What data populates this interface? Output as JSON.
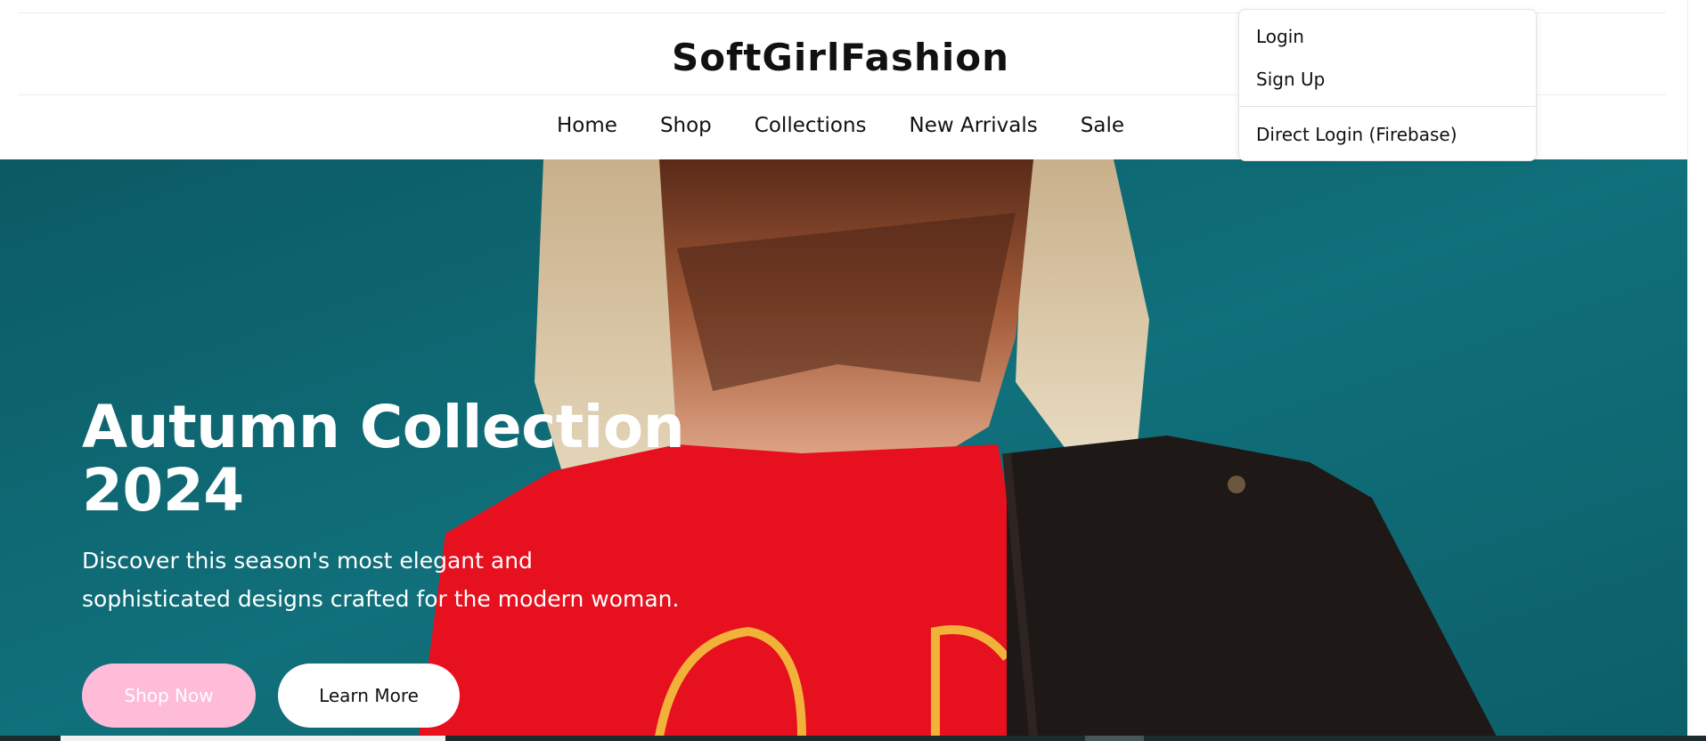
{
  "header": {
    "brand": "SoftGirlFashion"
  },
  "nav": {
    "items": [
      {
        "label": "Home"
      },
      {
        "label": "Shop"
      },
      {
        "label": "Collections"
      },
      {
        "label": "New Arrivals"
      },
      {
        "label": "Sale"
      }
    ]
  },
  "account_menu": {
    "login": "Login",
    "signup": "Sign Up",
    "direct_login": "Direct Login (Firebase)"
  },
  "hero": {
    "title_line1": "Autumn Collection",
    "title_line2": "2024",
    "subtitle": "Discover this season's most elegant and sophisticated designs crafted for the modern woman.",
    "shop_now": "Shop Now",
    "learn_more": "Learn More",
    "image": "model-red-tshirt-black-jacket-photo"
  },
  "colors": {
    "hero_background": "#0f6570",
    "shop_now_button": "#ffbcd9",
    "learn_more_button": "#ffffff",
    "tshirt_red": "#e6101e",
    "jacket_black": "#1e1816"
  }
}
